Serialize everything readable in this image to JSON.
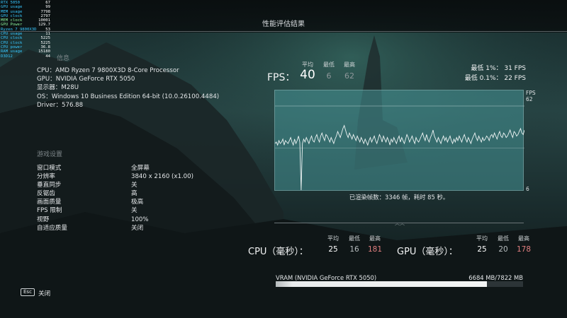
{
  "window": {
    "title": "性能评估结果",
    "close_key": "Esc",
    "close_label": "关闭"
  },
  "overlay": {
    "rows": [
      {
        "k": "RTX 5050",
        "v": "67"
      },
      {
        "k": "GPU usage",
        "v": "99"
      },
      {
        "k": "MEM usage",
        "v": "7798"
      },
      {
        "k": "GPU clock",
        "v": "2797"
      },
      {
        "k": "MEM clock",
        "v": "10001"
      },
      {
        "k": "GPU Power",
        "v": "129.7"
      },
      {
        "k": "Ryzen 7 9800X3D",
        "v": "53"
      },
      {
        "k": "CPU usage",
        "v": "11"
      },
      {
        "k": "CPU clock",
        "v": "5225"
      },
      {
        "k": "CPU clock",
        "v": "5225"
      },
      {
        "k": "CPU power",
        "v": "36.8"
      },
      {
        "k": "RAM usage",
        "v": "15180"
      },
      {
        "k": "D3D12",
        "v": "44"
      }
    ]
  },
  "system": {
    "section_label": "信息",
    "cpu": "CPU：AMD Ryzen 7 9800X3D 8-Core Processor",
    "gpu": "GPU：NVIDIA GeForce RTX 5050",
    "display": "显示器：M28U",
    "os": "OS：Windows 10 Business Edition 64-bit (10.0.26100.4484)",
    "driver": "Driver：576.88"
  },
  "settings": {
    "section_label": "游戏设置",
    "rows": [
      {
        "k": "窗口模式",
        "v": "全屏幕"
      },
      {
        "k": "分辨率",
        "v": "3840 x 2160 (x1.00)"
      },
      {
        "k": "垂直同步",
        "v": "关"
      },
      {
        "k": "反锯齿",
        "v": "高"
      },
      {
        "k": "画面质量",
        "v": "极高"
      },
      {
        "k": "FPS 限制",
        "v": "关"
      },
      {
        "k": "视野",
        "v": "100%"
      },
      {
        "k": "自适应质量",
        "v": "关闭"
      }
    ]
  },
  "fps": {
    "label": "FPS：",
    "hdr_avg": "平均",
    "hdr_min": "最低",
    "hdr_max": "最高",
    "avg": "40",
    "min": "6",
    "max": "62",
    "low1": "最低 1%：  31 FPS",
    "low01": "最低 0.1%：  22 FPS",
    "axis_unit": "FPS",
    "axis_max": "62",
    "axis_min": "6",
    "frames_text": "已渲染帧数：3346 帧，耗时 85 秒。"
  },
  "cpu": {
    "label": "CPU（毫秒）：",
    "hdr_avg": "平均",
    "hdr_min": "最低",
    "hdr_max": "最高",
    "avg": "25",
    "min": "16",
    "max": "181"
  },
  "gpu": {
    "label": "GPU（毫秒）：",
    "hdr_avg": "平均",
    "hdr_min": "最低",
    "hdr_max": "最高",
    "avg": "25",
    "min": "20",
    "max": "178"
  },
  "vram": {
    "label": "VRAM (NVIDIA GeForce RTX 5050)",
    "value": "6684 MB/7822 MB",
    "used_mb": 6684,
    "total_mb": 7822
  },
  "chart_data": {
    "type": "line",
    "series": [
      {
        "values": [
          37,
          38,
          36,
          39,
          37,
          38,
          40,
          36,
          39,
          38,
          37,
          39,
          41,
          38,
          36,
          40,
          37,
          39,
          42,
          38,
          6,
          37,
          40,
          38,
          41,
          39,
          37,
          40,
          42,
          39,
          38,
          41,
          43,
          40,
          38,
          42,
          44,
          41,
          39,
          43,
          42,
          40,
          38,
          41,
          39,
          37,
          40,
          42,
          45,
          43,
          41,
          44,
          47,
          49,
          46,
          43,
          41,
          44,
          42,
          40,
          43,
          41,
          39,
          42,
          40,
          38,
          41,
          39,
          37,
          40,
          38,
          36,
          39,
          41,
          38,
          40,
          42,
          39,
          37,
          40,
          43,
          41,
          38,
          42,
          40,
          38,
          41,
          39,
          36,
          40,
          38,
          41,
          39,
          37,
          40,
          42,
          38,
          41,
          39,
          37,
          40,
          43,
          41,
          38,
          40,
          42,
          39,
          37,
          41,
          39,
          38,
          40,
          42,
          44,
          41,
          39,
          43,
          40,
          38,
          41,
          43,
          46,
          42,
          40,
          38,
          41,
          39,
          37,
          40,
          42,
          39,
          41,
          38,
          40,
          42,
          39,
          37,
          40,
          38,
          41,
          39,
          42,
          40,
          38,
          41,
          43,
          40,
          38,
          41,
          39,
          37,
          40,
          42,
          44,
          41,
          39,
          42,
          40,
          38,
          41,
          39,
          40,
          42,
          41,
          39,
          42,
          43,
          41,
          44,
          42,
          40,
          43,
          45,
          42,
          41,
          44,
          43,
          41,
          42,
          44,
          46,
          43,
          41,
          45,
          44,
          42,
          43,
          45,
          47,
          44,
          43,
          46
        ]
      }
    ],
    "ylim": [
      6,
      62
    ],
    "y_ticks": [
      "62",
      "6"
    ],
    "y_unit": "FPS"
  }
}
